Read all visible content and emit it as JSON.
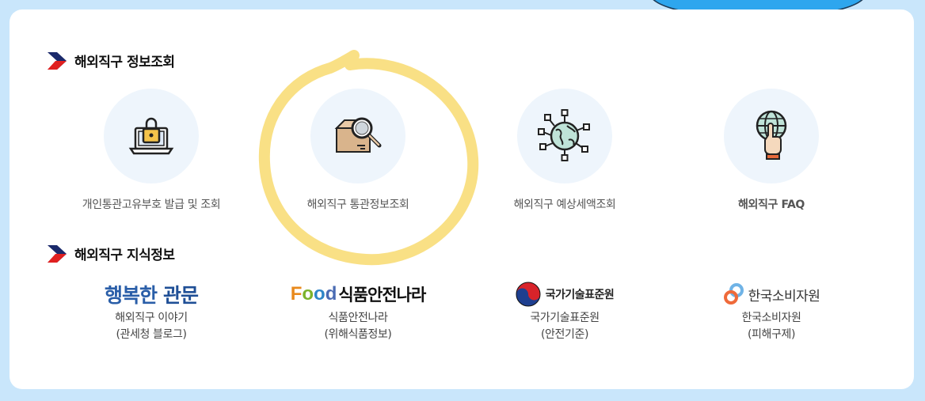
{
  "sections": {
    "info": {
      "title": "해외직구 정보조회"
    },
    "knowledge": {
      "title": "해외직구 지식정보"
    }
  },
  "services": [
    {
      "label": "개인통관고유부호 발급 및 조회",
      "icon": "laptop-lock-icon"
    },
    {
      "label": "해외직구 통관정보조회",
      "icon": "package-search-icon"
    },
    {
      "label": "해외직구 예상세액조회",
      "icon": "globe-network-icon"
    },
    {
      "label": "해외직구 FAQ",
      "icon": "globe-pointer-icon"
    }
  ],
  "knowledge_links": [
    {
      "logo_text": "행복한 관문",
      "logo_word1": "행복한",
      "logo_word2": "관문",
      "line1": "해외직구 이야기",
      "line2": "(관세청 블로그)"
    },
    {
      "logo_text": "Food 식품안전나라",
      "logo_food": "Food",
      "logo_name": "식품안전나라",
      "line1": "식품안전나라",
      "line2": "(위해식품정보)"
    },
    {
      "logo_text": "국가기술표준원",
      "line1": "국가기술표준원",
      "line2": "(안전기준)"
    },
    {
      "logo_text": "한국소비자원",
      "line1": "한국소비자원",
      "line2": "(피해구제)"
    }
  ],
  "colors": {
    "page_bg": "#c9e6fb",
    "card_bg": "#ffffff",
    "chevron_navy": "#1b2a6b",
    "chevron_red": "#e02020",
    "highlight": "#f7d55c",
    "icon_circle": "#eef5fc"
  }
}
